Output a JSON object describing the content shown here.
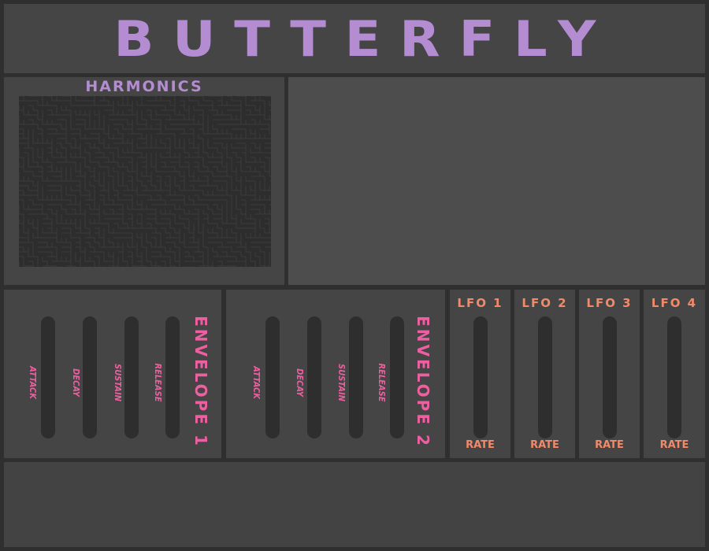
{
  "app": {
    "title": "BUTTERFLY",
    "accent_purple": "#b48cd2",
    "accent_pink": "#ec5fa0",
    "accent_orange": "#f28a6a"
  },
  "harmonics": {
    "title": "HARMONICS"
  },
  "envelopes": [
    {
      "title": "ENVELOPE 1",
      "sliders": [
        "ATTACK",
        "DECAY",
        "SUSTAIN",
        "RELEASE"
      ]
    },
    {
      "title": "ENVELOPE 2",
      "sliders": [
        "ATTACK",
        "DECAY",
        "SUSTAIN",
        "RELEASE"
      ]
    }
  ],
  "lfos": [
    {
      "title": "LFO 1",
      "knob_label": "RATE"
    },
    {
      "title": "LFO 2",
      "knob_label": "RATE"
    },
    {
      "title": "LFO 3",
      "knob_label": "RATE"
    },
    {
      "title": "LFO 4",
      "knob_label": "RATE"
    }
  ]
}
